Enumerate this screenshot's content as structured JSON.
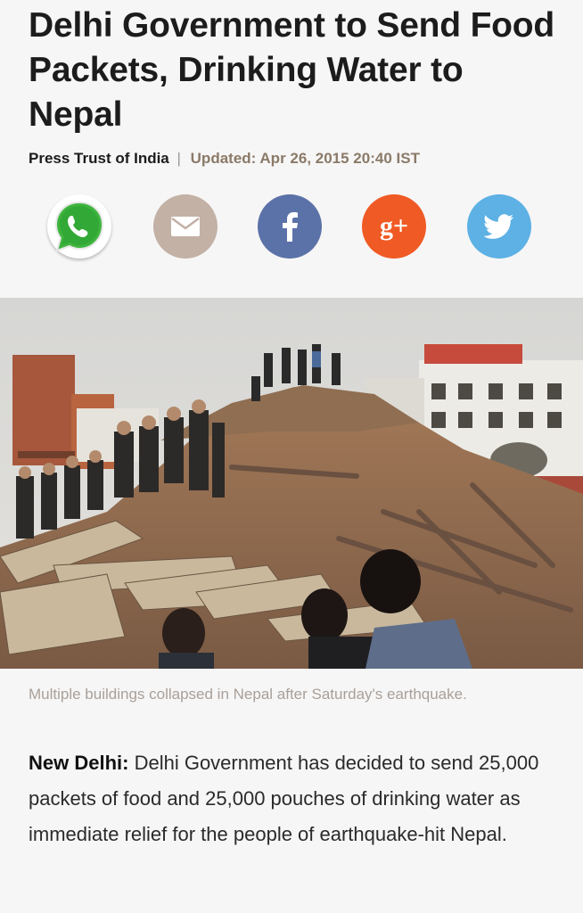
{
  "article": {
    "headline": "Delhi Government to Send Food Packets, Drinking Water to Nepal",
    "author": "Press Trust of India",
    "separator": "|",
    "updated": "Updated: Apr 26, 2015 20:40 IST",
    "caption": "Multiple buildings collapsed in Nepal after Saturday's earthquake.",
    "dateline": "New Delhi:",
    "body": " Delhi Government has decided to send 25,000 packets of food and 25,000 pouches of drinking water as immediate relief for the people of earthquake-hit Nepal."
  },
  "share": [
    {
      "name": "whatsapp",
      "icon": "whatsapp-icon",
      "color": "#ffffff"
    },
    {
      "name": "email",
      "icon": "mail-icon",
      "color": "#c3b1a6"
    },
    {
      "name": "facebook",
      "icon": "facebook-icon",
      "color": "#5b72a8"
    },
    {
      "name": "google-plus",
      "icon": "google-plus-icon",
      "color": "#f05a24",
      "glyph": "g+"
    },
    {
      "name": "twitter",
      "icon": "twitter-icon",
      "color": "#5db1e4"
    }
  ],
  "photo": {
    "subject": "earthquake-collapsed-temple-rubble"
  }
}
